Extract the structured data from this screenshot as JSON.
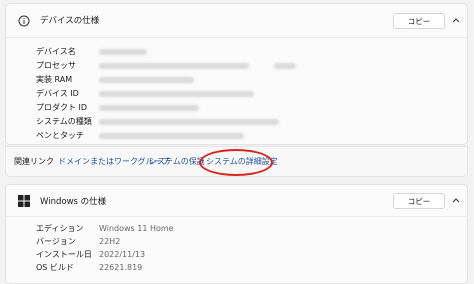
{
  "device_spec": {
    "title": "デバイスの仕様",
    "copy_label": "コピー",
    "rows": [
      {
        "label": "デバイス名"
      },
      {
        "label": "プロセッサ"
      },
      {
        "label": "実装 RAM"
      },
      {
        "label": "デバイス ID"
      },
      {
        "label": "プロダクト ID"
      },
      {
        "label": "システムの種類"
      },
      {
        "label": "ペンとタッチ"
      }
    ]
  },
  "related_links": {
    "title": "関連リンク",
    "links": [
      "ドメインまたはワークグループ",
      "システムの保護",
      "システムの詳細設定"
    ],
    "highlight_color": "#d9251d"
  },
  "windows_spec": {
    "title": "Windows の仕様",
    "copy_label": "コピー",
    "rows": [
      {
        "label": "エディション",
        "value": "Windows 11 Home"
      },
      {
        "label": "バージョン",
        "value": "22H2"
      },
      {
        "label": "インストール日",
        "value": "2022/11/13"
      },
      {
        "label": "OS ビルド",
        "value": "22621.819"
      }
    ]
  },
  "colors": {
    "accent_link": "#1f4f9e",
    "background": "#f3f3f3"
  },
  "icons": {
    "device_spec": "info-icon",
    "windows_spec": "windows-logo-icon",
    "expand": "chevron-up-icon"
  }
}
